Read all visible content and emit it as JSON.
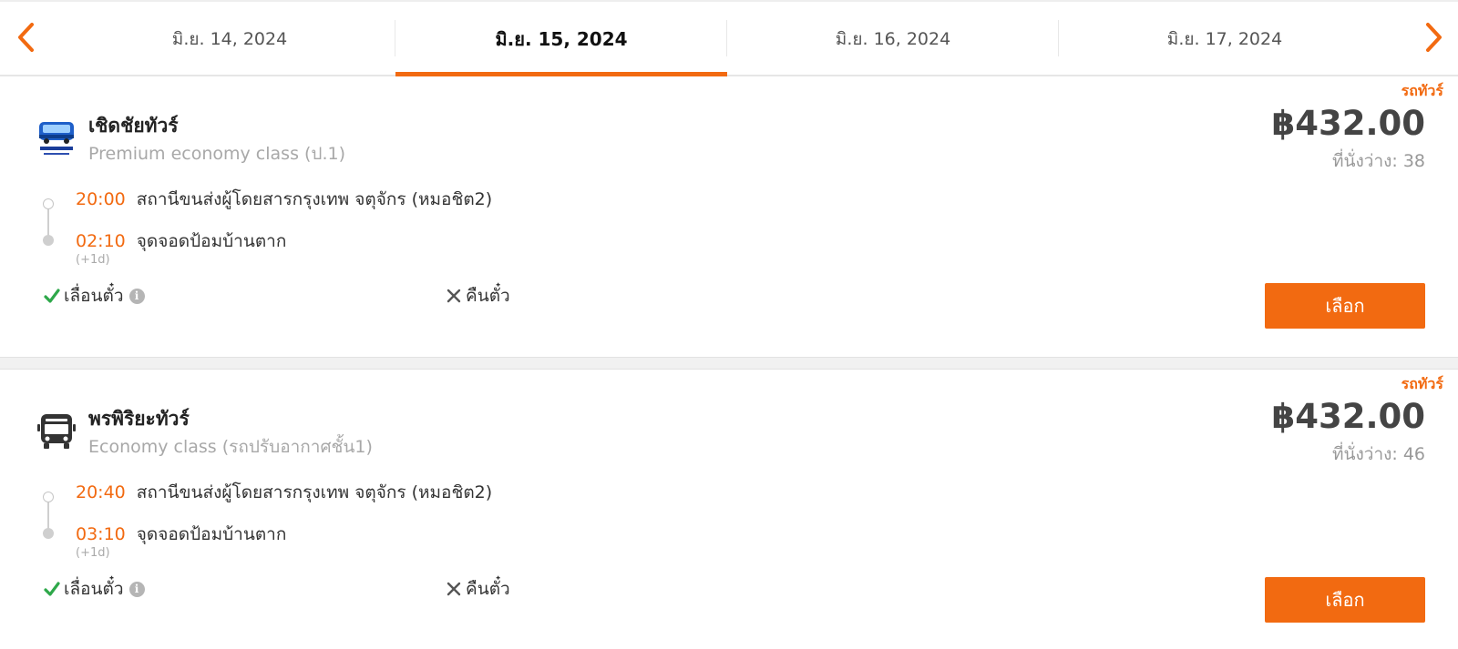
{
  "date_tabs": {
    "tabs": [
      {
        "label": "มิ.ย. 14, 2024"
      },
      {
        "label": "มิ.ย. 15, 2024"
      },
      {
        "label": "มิ.ย. 16, 2024"
      },
      {
        "label": "มิ.ย. 17, 2024"
      }
    ],
    "active_index": 1,
    "prev_icon": "chevron-left-icon",
    "next_icon": "chevron-right-icon"
  },
  "colors": {
    "accent": "#f26a11",
    "success": "#2ea84a",
    "text": "#333333",
    "muted": "#a8a8a8"
  },
  "trips": [
    {
      "tag": "รถทัวร์",
      "operator": "เชิดชัยทัวร์",
      "logo_icon": "cherdchai-tour-logo",
      "bus_class": "Premium economy class (ป.1)",
      "price": "฿432.00",
      "seats_label": "ที่นั่งว่าง:",
      "seats_count": "38",
      "departure_time": "20:00",
      "departure_place": "สถานีขนส่งผู้โดยสารกรุงเทพ จตุจักร (หมอชิต2)",
      "arrival_time": "02:10",
      "arrival_place": "จุดจอดป้อมบ้านตาก",
      "next_day": "(+1d)",
      "change_label": "เลื่อนตั๋ว",
      "refund_label": "คืนตั๋ว",
      "select_label": "เลือก"
    },
    {
      "tag": "รถทัวร์",
      "operator": "พรพิริยะทัวร์",
      "logo_icon": "bus-icon",
      "bus_class": "Economy class (รถปรับอากาศชั้น1)",
      "price": "฿432.00",
      "seats_label": "ที่นั่งว่าง:",
      "seats_count": "46",
      "departure_time": "20:40",
      "departure_place": "สถานีขนส่งผู้โดยสารกรุงเทพ จตุจักร (หมอชิต2)",
      "arrival_time": "03:10",
      "arrival_place": "จุดจอดป้อมบ้านตาก",
      "next_day": "(+1d)",
      "change_label": "เลื่อนตั๋ว",
      "refund_label": "คืนตั๋ว",
      "select_label": "เลือก"
    }
  ]
}
